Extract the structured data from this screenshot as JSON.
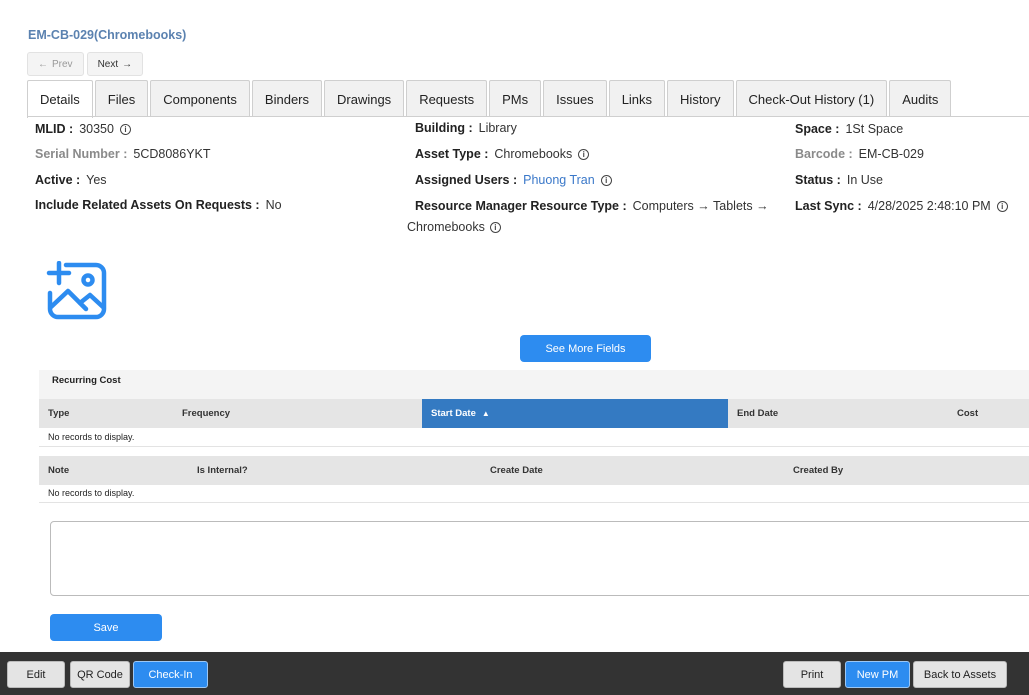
{
  "asset": {
    "title": "EM-CB-029(Chromebooks)"
  },
  "pager": {
    "prev": "Prev",
    "next": "Next"
  },
  "tabs": [
    "Details",
    "Files",
    "Components",
    "Binders",
    "Drawings",
    "Requests",
    "PMs",
    "Issues",
    "Links",
    "History",
    "Check-Out History (1)",
    "Audits"
  ],
  "fields": {
    "mlid": {
      "label": "MLID :",
      "value": "30350"
    },
    "serial": {
      "label": "Serial Number :",
      "value": "5CD8086YKT"
    },
    "active": {
      "label": "Active :",
      "value": "Yes"
    },
    "include_related": {
      "label": "Include Related Assets On Requests :",
      "value": "No"
    },
    "building": {
      "label": "Building :",
      "value": "Library"
    },
    "asset_type": {
      "label": "Asset Type :",
      "value": "Chromebooks"
    },
    "assigned_users": {
      "label": "Assigned Users :",
      "value": "Phuong Tran"
    },
    "rm_type": {
      "label": "Resource Manager Resource Type :",
      "value": "Computers → Tablets →",
      "value_cont": "Chromebooks"
    },
    "space": {
      "label": "Space :",
      "value": "1St Space"
    },
    "barcode": {
      "label": "Barcode :",
      "value": "EM-CB-029"
    },
    "status": {
      "label": "Status :",
      "value": "In Use"
    },
    "last_sync": {
      "label": "Last Sync :",
      "value": "4/28/2025 2:48:10 PM"
    }
  },
  "see_more": "See More Fields",
  "recurring_cost": {
    "title": "Recurring Cost",
    "columns": [
      "Type",
      "Frequency",
      "Start Date",
      "End Date",
      "Cost"
    ],
    "empty": "No records to display."
  },
  "notes": {
    "columns": [
      "Note",
      "Is Internal?",
      "Create Date",
      "Created By"
    ],
    "empty": "No records to display."
  },
  "save": "Save",
  "footer": {
    "edit": "Edit",
    "qr": "QR Code",
    "checkin": "Check-In",
    "print": "Print",
    "new_pm": "New PM",
    "back": "Back to Assets"
  },
  "colors": {
    "primary": "#2d8cf0",
    "sorted_header": "#347ac2",
    "title": "#5b82b0",
    "footer": "#333333"
  }
}
